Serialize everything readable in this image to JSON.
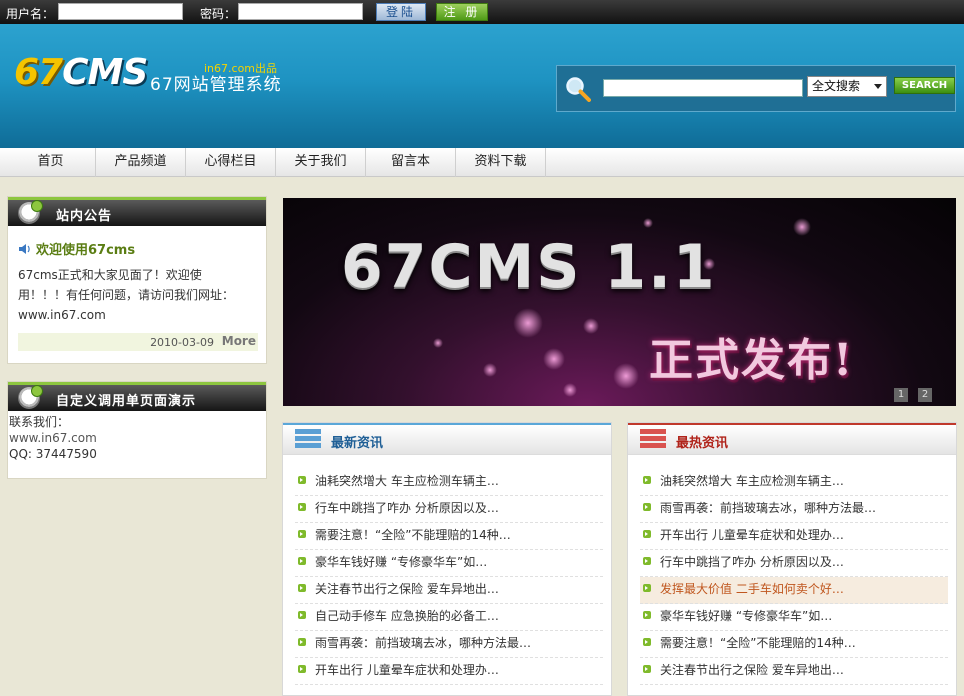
{
  "topbar": {
    "username_label": "用户名：",
    "password_label": "密码：",
    "login_label": "登陆",
    "register_label": "注 册"
  },
  "header": {
    "logo_numeric": "67",
    "logo_text": "CMS",
    "site_name": "67网站管理系统",
    "site_tag": "in67.com出品",
    "search": {
      "select_value": "全文搜索",
      "button_label": "SEARCH"
    }
  },
  "nav": {
    "items": [
      "首页",
      "产品频道",
      "心得栏目",
      "关于我们",
      "留言本",
      "资料下载"
    ]
  },
  "notice": {
    "heading": "站内公告",
    "title": "欢迎使用67cms",
    "line1": "67cms正式和大家见面了！欢迎使",
    "line2": "用！！！有任何问题，请访问我们网址：",
    "line3": "www.in67.com",
    "date": "2010-03-09",
    "more": "More"
  },
  "custom": {
    "heading": "自定义调用单页面演示",
    "line1": "联系我们：",
    "line2": "www.in67.com",
    "line3": "QQ: 37447590"
  },
  "banner": {
    "line1": "67CMS 1.1",
    "line2": "正式发布!",
    "pages": [
      "1",
      "2"
    ]
  },
  "latest": {
    "heading": "最新资讯",
    "items": [
      "油耗突然增大 车主应检测车辆主…",
      "行车中跳挡了咋办 分析原因以及…",
      "需要注意！“全险”不能理赔的14种…",
      "豪华车钱好赚 “专修豪华车”如…",
      "关注春节出行之保险 爱车异地出…",
      "自己动手修车 应急换胎的必备工…",
      "雨雪再袭：前挡玻璃去冰，哪种方法最…",
      "开车出行 儿童晕车症状和处理办…"
    ]
  },
  "hot": {
    "heading": "最热资讯",
    "items": [
      "油耗突然增大 车主应检测车辆主…",
      "雨雪再袭：前挡玻璃去冰，哪种方法最…",
      "开车出行 儿童晕车症状和处理办…",
      "行车中跳挡了咋办 分析原因以及…",
      "发挥最大价值 二手车如何卖个好…",
      "豪华车钱好赚 “专修豪华车”如…",
      "需要注意！“全险”不能理赔的14种…",
      "关注春节出行之保险 爱车异地出…"
    ],
    "highlighted_index": 4
  }
}
